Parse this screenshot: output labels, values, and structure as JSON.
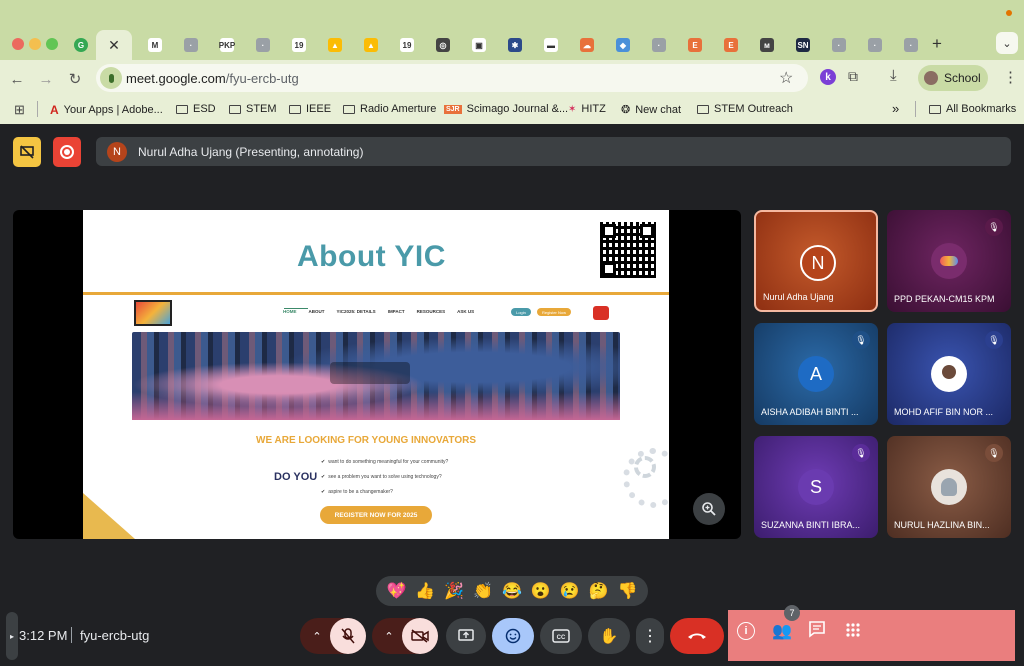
{
  "browser": {
    "url_host": "meet.google.com",
    "url_path": "/fyu-ercb-utg",
    "profile_label": "School",
    "new_tab_symbol": "+",
    "tab_icons": [
      "G",
      "M",
      "·",
      "PKP",
      "·",
      "19",
      "▲",
      "▲",
      "19",
      "◎",
      "▣",
      "✱",
      "▬",
      "☁",
      "◆",
      "·",
      "E",
      "E",
      "ᴍ",
      "SN",
      "·",
      "·",
      "·"
    ],
    "bookmarks": [
      "Your Apps | Adobe...",
      "ESD",
      "STEM",
      "IEEE",
      "Radio Amerture",
      "Scimago Journal &...",
      "HITZ",
      "New chat",
      "STEM Outreach"
    ],
    "all_bookmarks_label": "All Bookmarks",
    "more_symbol": "»"
  },
  "meet": {
    "presenter_initial": "N",
    "presenter_status": "Nurul Adha Ujang (Presenting, annotating)",
    "time": "3:12 PM",
    "meeting_code": "fyu-ercb-utg",
    "participant_count": "7",
    "reactions": [
      "💖",
      "👍",
      "🎉",
      "👏",
      "😂",
      "😮",
      "😢",
      "🤔",
      "👎"
    ]
  },
  "slide": {
    "title": "About YIC",
    "site_nav": [
      "HOME",
      "ABOUT",
      "YIC2025: DETAILS",
      "IMPACT",
      "RESOURCES",
      "ASK US"
    ],
    "login_label": "Login",
    "register_label": "Register Now",
    "heading": "WE ARE LOOKING FOR YOUNG INNOVATORS",
    "do_you": "DO YOU",
    "bullets": [
      "want to do something meaningful for your community?",
      "see a problem you want to solve using technology?",
      "aspire to be a changemaker?"
    ],
    "cta": "REGISTER NOW FOR 2025"
  },
  "participants": [
    {
      "name": "Nurul Adha Ujang",
      "initial": "N",
      "color": "#b5441b"
    },
    {
      "name": "PPD PEKAN-CM15 KPM",
      "initial": "",
      "color": "#5a1a4a"
    },
    {
      "name": "AISHA ADIBAH BINTI ...",
      "initial": "A",
      "color": "#1e4f86"
    },
    {
      "name": "MOHD AFIF BIN NOR ...",
      "initial": "",
      "color": "#2b3f8f"
    },
    {
      "name": "SUZANNA BINTI IBRA...",
      "initial": "S",
      "color": "#5a2c99"
    },
    {
      "name": "NURUL HAZLINA BIN...",
      "initial": "",
      "color": "#7a4d3a"
    }
  ],
  "colors": {
    "end_call": "#d93025",
    "accent_blue": "#8ab4f8",
    "teal_title": "#4a9aa9",
    "orange": "#e8a839"
  }
}
